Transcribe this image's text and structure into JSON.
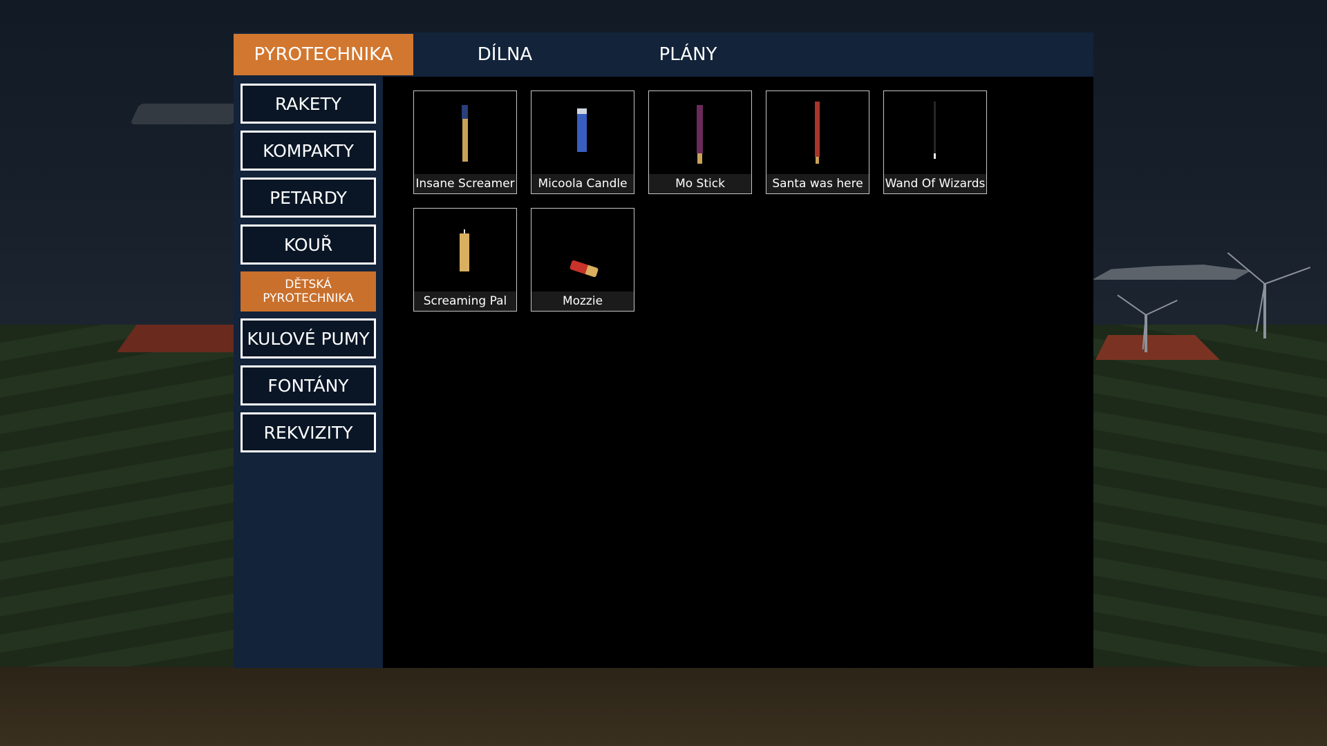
{
  "tabs": [
    {
      "label": "PYROTECHNIKA",
      "active": true
    },
    {
      "label": "DÍLNA",
      "active": false
    },
    {
      "label": "PLÁNY",
      "active": false
    }
  ],
  "categories": [
    {
      "label": "RAKETY",
      "active": false
    },
    {
      "label": "KOMPAKTY",
      "active": false
    },
    {
      "label": "PETARDY",
      "active": false
    },
    {
      "label": "KOUŘ",
      "active": false
    },
    {
      "label": "DĚTSKÁ PYROTECHNIKA",
      "active": true
    },
    {
      "label": "KULOVÉ PUMY",
      "active": false
    },
    {
      "label": "FONTÁNY",
      "active": false
    },
    {
      "label": "REKVIZITY",
      "active": false
    }
  ],
  "items": [
    {
      "name": "Insane Screamer",
      "icon": "firework-stick-icon"
    },
    {
      "name": "Micoola Candle",
      "icon": "candle-icon"
    },
    {
      "name": "Mo Stick",
      "icon": "firework-stick-icon"
    },
    {
      "name": "Santa was here",
      "icon": "firework-stick-icon"
    },
    {
      "name": "Wand Of Wizards",
      "icon": "sparkler-icon"
    },
    {
      "name": "Screaming Pal",
      "icon": "candle-icon"
    },
    {
      "name": "Mozzie",
      "icon": "firecracker-icon"
    }
  ],
  "colors": {
    "accent": "#d2772f",
    "panel": "#12233a",
    "content": "#000000"
  }
}
